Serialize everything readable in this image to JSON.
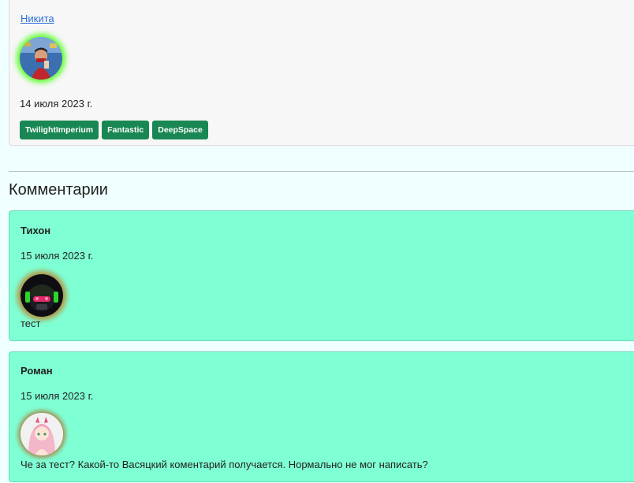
{
  "post": {
    "author": "Никита",
    "date": "14 июля 2023 г.",
    "tags": [
      "TwilightImperium",
      "Fantastic",
      "DeepSpace"
    ]
  },
  "comments_title": "Комментарии",
  "comments": [
    {
      "author": "Тихон",
      "date": "15 июля 2023 г.",
      "text": "тест"
    },
    {
      "author": "Роман",
      "date": "15 июля 2023 г.",
      "text": "Че за тест? Какой-то Васяцкий коментарий получается. Нормально не мог написать?"
    }
  ],
  "colors": {
    "page_background": "#f0ffff",
    "comment_background": "#7fffd4",
    "tag_background": "#198754",
    "link": "#2f6fd8"
  }
}
